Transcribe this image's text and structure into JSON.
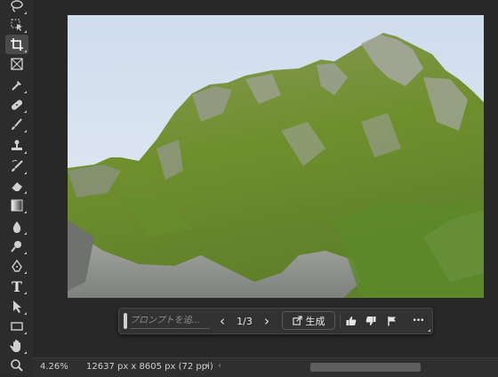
{
  "toolbar": {
    "tools": [
      {
        "name": "lasso-tool"
      },
      {
        "name": "object-selection-tool"
      },
      {
        "name": "crop-tool",
        "active": true
      },
      {
        "name": "frame-tool"
      },
      {
        "name": "eyedropper-tool"
      },
      {
        "name": "healing-brush-tool"
      },
      {
        "name": "brush-tool"
      },
      {
        "name": "clone-stamp-tool"
      },
      {
        "name": "history-brush-tool"
      },
      {
        "name": "eraser-tool"
      },
      {
        "name": "gradient-tool"
      },
      {
        "name": "blur-tool"
      },
      {
        "name": "dodge-tool"
      },
      {
        "name": "pen-tool"
      },
      {
        "name": "type-tool"
      },
      {
        "name": "path-selection-tool"
      },
      {
        "name": "rectangle-tool"
      },
      {
        "name": "hand-tool"
      },
      {
        "name": "zoom-tool"
      }
    ],
    "type_tool_glyph": "T"
  },
  "taskbar": {
    "prompt_placeholder": "プロンプトを追...",
    "page_counter": "1/3",
    "prev_glyph": "‹",
    "next_glyph": "›",
    "generate_label": "生成",
    "more_glyph": "•••"
  },
  "status": {
    "zoom": "4.26%",
    "doc_info": "12637 px x 8605 px (72 ppi)",
    "arrow_glyph": "›",
    "scroll_left_glyph": "‹"
  },
  "colors": {
    "app_bg": "#282828",
    "sky": "#dbe6f2",
    "grass": "#6f8f2e",
    "rock": "#9a9c98"
  }
}
